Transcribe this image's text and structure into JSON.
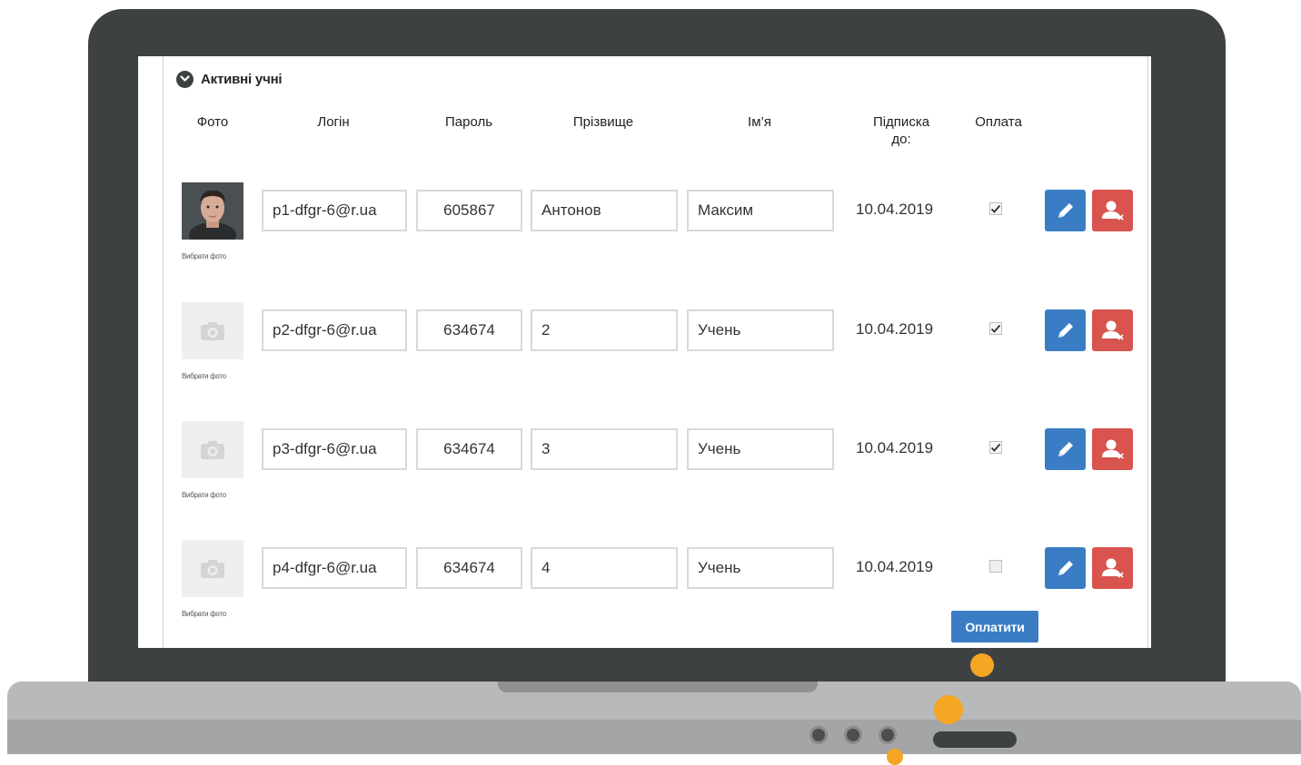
{
  "section": {
    "title": "Активні учні",
    "icon": "chevron-down-icon"
  },
  "columns": {
    "photo": "Фото",
    "login": "Логін",
    "password": "Пароль",
    "surname": "Прізвище",
    "name": "Ім’я",
    "subscription_line1": "Підписка",
    "subscription_line2": "до:",
    "payment": "Оплата"
  },
  "photo_caption": "Вибрати фото",
  "students": [
    {
      "login": "p1-dfgr-6@r.ua",
      "password": "605867",
      "surname": "Антонов",
      "name": "Максим",
      "subscription": "10.04.2019",
      "paid": true,
      "has_photo": true
    },
    {
      "login": "p2-dfgr-6@r.ua",
      "password": "634674",
      "surname": "2",
      "name": "Учень",
      "subscription": "10.04.2019",
      "paid": true,
      "has_photo": false
    },
    {
      "login": "p3-dfgr-6@r.ua",
      "password": "634674",
      "surname": "3",
      "name": "Учень",
      "subscription": "10.04.2019",
      "paid": true,
      "has_photo": false
    },
    {
      "login": "p4-dfgr-6@r.ua",
      "password": "634674",
      "surname": "4",
      "name": "Учень",
      "subscription": "10.04.2019",
      "paid": false,
      "has_photo": false
    }
  ],
  "actions": {
    "pay_label": "Оплатити",
    "edit_icon": "pencil-icon",
    "delete_icon": "remove-user-icon"
  },
  "colors": {
    "primary": "#3a7dc4",
    "danger": "#d9534f",
    "accent": "#f5a623",
    "frame": "#3e4142"
  }
}
